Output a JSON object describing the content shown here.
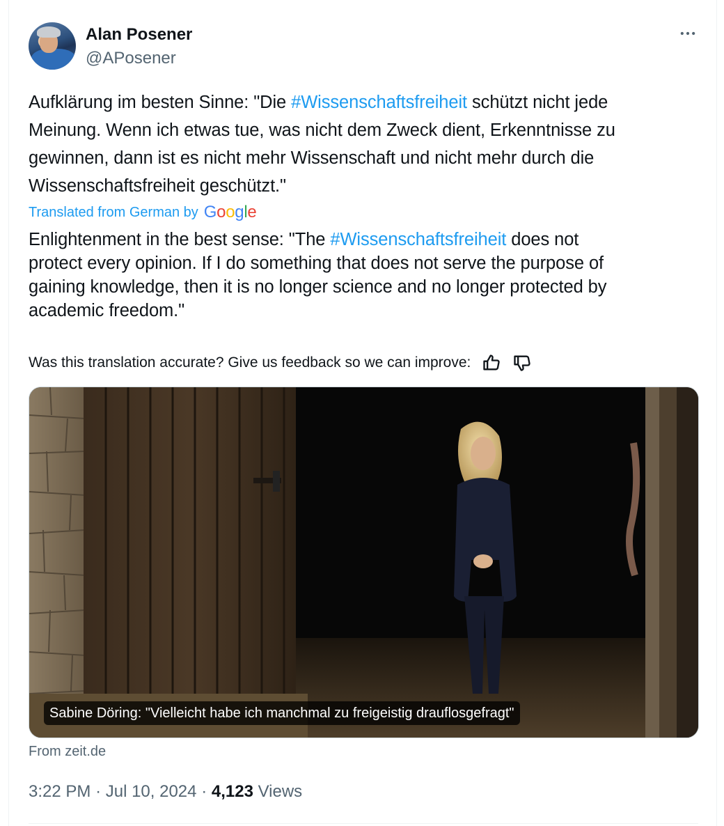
{
  "author": {
    "name": "Alan Posener",
    "handle": "@APosener"
  },
  "tweet": {
    "lines": [
      {
        "before": "Aufklärung im besten Sinne: \"Die ",
        "hashtag": "#Wissenschaftsfreiheit",
        "after": " schützt nicht jede"
      },
      {
        "text": "Meinung. Wenn ich etwas tue, was nicht dem Zweck dient, Erkenntnisse zu"
      },
      {
        "text": "gewinnen, dann ist es nicht mehr Wissenschaft und nicht mehr durch die"
      },
      {
        "text": "Wissenschaftsfreiheit geschützt.\""
      }
    ]
  },
  "translation": {
    "label": "Translated from German by",
    "provider": "Google",
    "lines": [
      {
        "before": "Enlightenment in the best sense: \"The ",
        "hashtag": "#Wissenschaftsfreiheit",
        "after": " does not"
      },
      {
        "text": "protect every opinion. If I do something that does not serve the purpose of"
      },
      {
        "text": "gaining knowledge, then it is no longer science and no longer protected by"
      },
      {
        "text": "academic freedom.\""
      }
    ],
    "feedback_prompt": "Was this translation accurate? Give us feedback so we can improve:",
    "thumbs_up_icon": "thumbs-up-icon",
    "thumbs_down_icon": "thumbs-down-icon"
  },
  "link_card": {
    "caption": "Sabine Döring: \"Vielleicht habe ich manchmal zu freigeistig drauflosgefragt\"",
    "source": "From zeit.de"
  },
  "meta": {
    "time": "3:22 PM",
    "date": "Jul 10, 2024",
    "views_count": "4,123",
    "views_label": "Views",
    "separator": "·"
  },
  "colors": {
    "link": "#1d9bf0",
    "secondary_text": "#536471",
    "primary_text": "#0f1419"
  }
}
